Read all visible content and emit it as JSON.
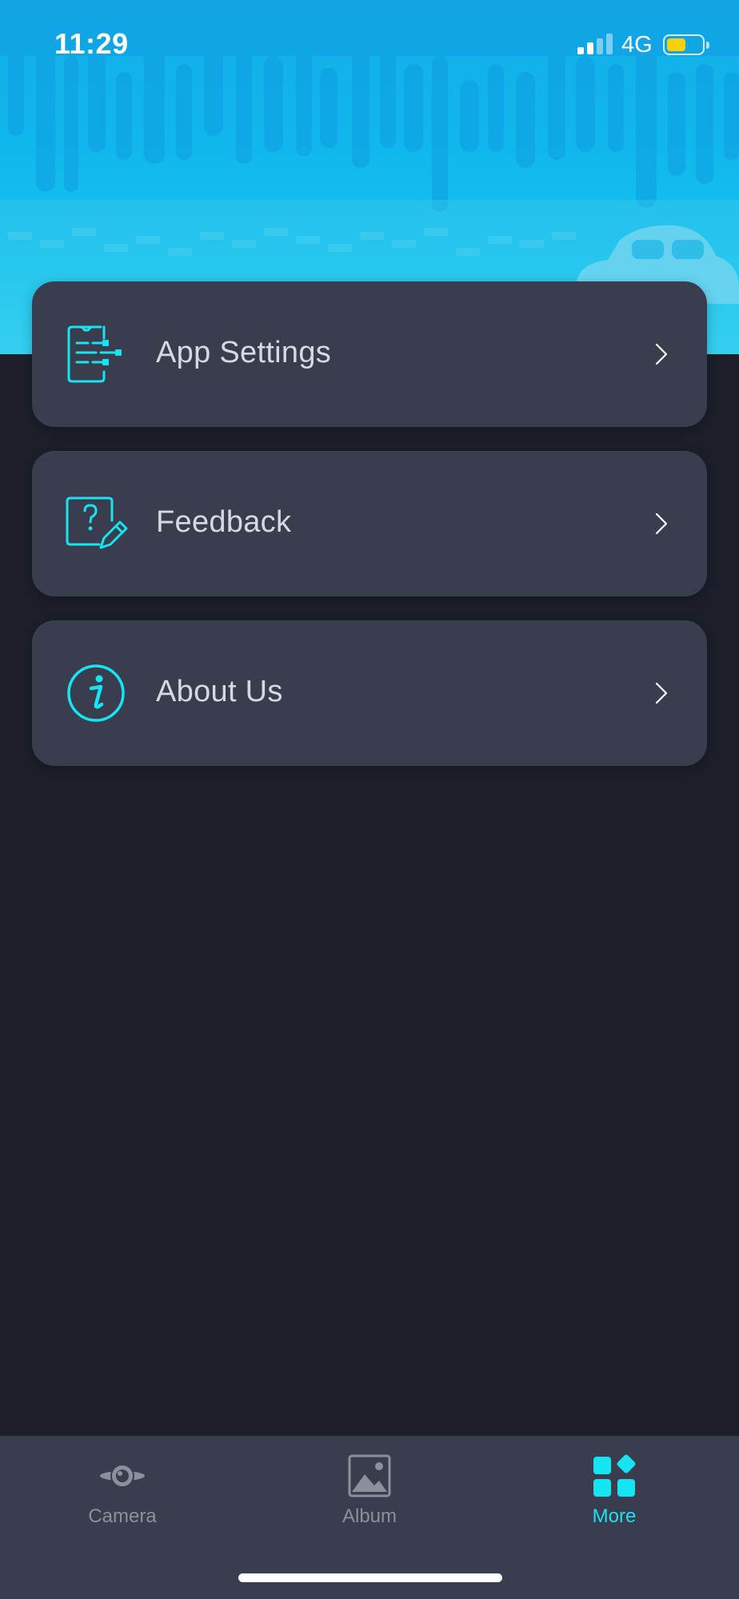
{
  "status_bar": {
    "time": "11:29",
    "network": "4G",
    "battery_level_fraction": 0.55,
    "battery_color": "#f5d20b"
  },
  "menu": {
    "items": [
      {
        "label": "App Settings",
        "icon": "settings-document-icon"
      },
      {
        "label": "Feedback",
        "icon": "feedback-edit-icon"
      },
      {
        "label": "About Us",
        "icon": "info-circle-icon"
      }
    ]
  },
  "tab_bar": {
    "tabs": [
      {
        "label": "Camera",
        "icon": "dashcam-icon",
        "active": false
      },
      {
        "label": "Album",
        "icon": "image-icon",
        "active": false
      },
      {
        "label": "More",
        "icon": "apps-grid-icon",
        "active": true
      }
    ]
  },
  "colors": {
    "accent": "#17e4f2",
    "background": "#1c1f2a",
    "card": "#393d4d",
    "banner": "#14aee8",
    "inactive_tab": "#8b8f9e"
  }
}
